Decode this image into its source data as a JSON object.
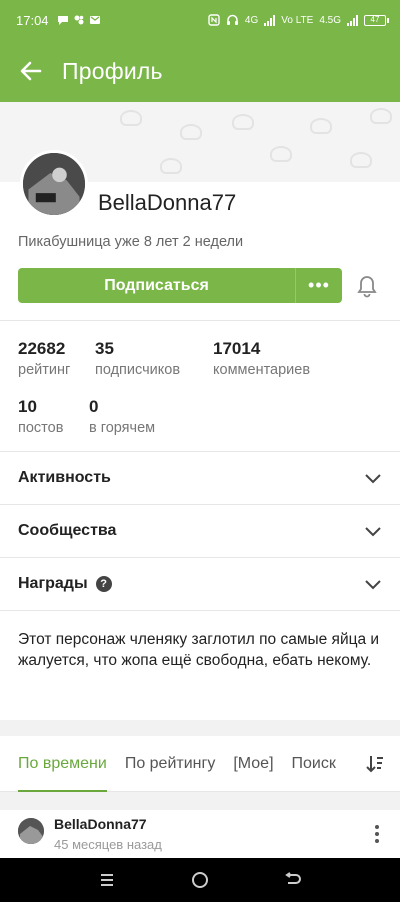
{
  "status_bar": {
    "time": "17:04",
    "network": "4G",
    "volte": "Vo LTE",
    "network2": "4.5G",
    "battery": "47"
  },
  "header": {
    "title": "Профиль",
    "accent_color": "#7ab648"
  },
  "profile": {
    "username": "BellaDonna77",
    "since": "Пикабушница уже 8 лет 2 недели",
    "subscribe_label": "Подписаться",
    "more_label": "•••"
  },
  "stats": [
    {
      "value": "22682",
      "caption": "рейтинг"
    },
    {
      "value": "35",
      "caption": "подписчиков"
    },
    {
      "value": "17014",
      "caption": "комментариев"
    },
    {
      "value": "10",
      "caption": "постов"
    },
    {
      "value": "0",
      "caption": "в горячем"
    }
  ],
  "sections": [
    {
      "label": "Активность"
    },
    {
      "label": "Сообщества"
    },
    {
      "label": "Награды",
      "help": "?"
    }
  ],
  "about": "Этот персонаж членяку заглотил по самые яйца и жалуется, что жопа ещё свободна, ебать некому.",
  "tabs": [
    {
      "label": "По времени",
      "active": true
    },
    {
      "label": "По рейтингу"
    },
    {
      "label": "[Мое]"
    },
    {
      "label": "Поиск"
    }
  ],
  "post": {
    "author": "BellaDonna77",
    "time": "45 месяцев назад"
  }
}
